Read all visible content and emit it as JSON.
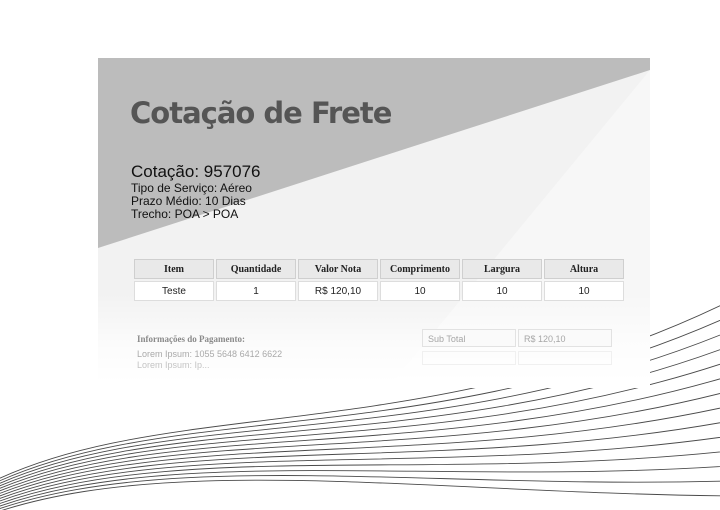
{
  "document": {
    "title": "Cotação de Frete",
    "quote_number": "Cotação: 957076",
    "service_type": "Tipo de Serviço: Aéreo",
    "avg_deadline": "Prazo Médio: 10 Dias",
    "route": "Trecho: POA > POA"
  },
  "items_table": {
    "headers": [
      "Item",
      "Quantidade",
      "Valor Nota",
      "Comprimento",
      "Largura",
      "Altura"
    ],
    "rows": [
      [
        "Teste",
        "1",
        "R$ 120,10",
        "10",
        "10",
        "10"
      ]
    ]
  },
  "payment": {
    "title": "Informações do Pagamento:",
    "line1": "Lorem Ipsum: 1055 5648 6412 6622",
    "line2": "Lorem Ipsum: Ip..."
  },
  "summary": {
    "subtotal_label": "Sub Total",
    "subtotal_value": "R$ 120,10"
  },
  "colors": {
    "header_band": "#bcbcbc",
    "page_background": "#f2f2f2",
    "wave_lines": "#4a4a4a"
  }
}
